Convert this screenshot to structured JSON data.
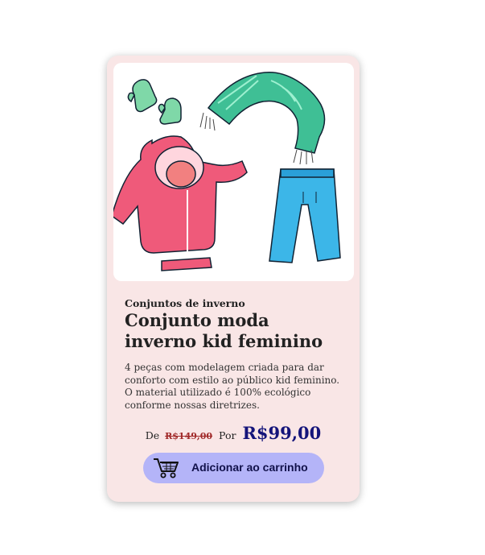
{
  "product": {
    "category": "Conjuntos de inverno",
    "title": "Conjunto moda inverno kid feminino",
    "description": "4 peças com modelagem criada para dar conforto com estilo ao público kid feminino. O material utilizado é 100% ecológico conforme nossas diretrizes.",
    "image_icon": "winter-clothes-illustration",
    "price": {
      "from_label": "De",
      "old_price": "R$149,00",
      "to_label": "Por",
      "new_price": "R$99,00"
    },
    "cart_button": {
      "label": "Adicionar ao carrinho",
      "icon": "shopping-cart-icon"
    }
  },
  "colors": {
    "card_background": "#f9e6e6",
    "button_background": "#b4b4f8",
    "price_color": "#14147a",
    "old_price_color": "#a12a2a"
  }
}
